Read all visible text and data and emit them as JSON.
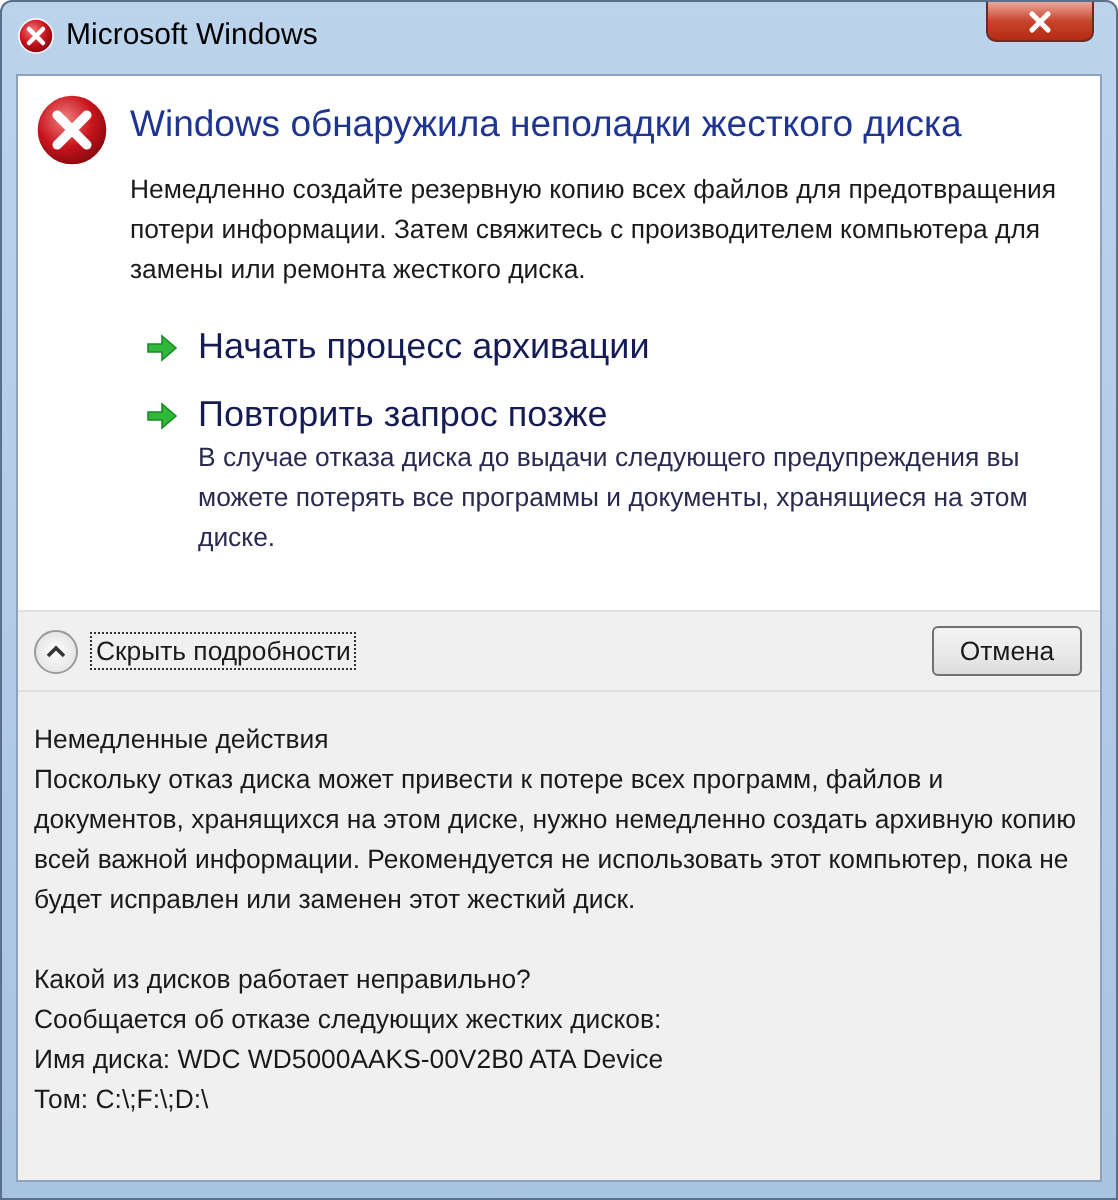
{
  "window": {
    "title": "Microsoft Windows"
  },
  "heading": "Windows обнаружила неполадки жесткого диска",
  "description": "Немедленно создайте резервную копию всех файлов для предотвращения потери информации. Затем свяжитесь с производителем компьютера для замены или ремонта жесткого диска.",
  "commands": [
    {
      "label": "Начать процесс архивации"
    },
    {
      "label": "Повторить запрос позже",
      "note": "В случае отказа диска до выдачи следующего предупреждения вы можете потерять все программы и документы, хранящиеся на этом диске."
    }
  ],
  "footer": {
    "toggle": {
      "label": "Скрыть подробности",
      "expanded": true,
      "focused": true
    },
    "buttons": [
      {
        "label": "Отмена"
      }
    ]
  },
  "details": [
    [
      "Немедленные действия",
      "Поскольку отказ диска может привести к потере всех программ, файлов и документов, хранящихся на этом диске, нужно немедленно создать архивную копию всей важной информации.  Рекомендуется не использовать этот компьютер, пока не будет исправлен или заменен этот жесткий диск."
    ],
    [
      "Какой из дисков работает неправильно?",
      "Сообщается об отказе следующих жестких дисков:",
      "Имя диска: WDC WD5000AAKS-00V2B0 ATA Device",
      "Том: C:\\;F:\\;D:\\"
    ]
  ]
}
